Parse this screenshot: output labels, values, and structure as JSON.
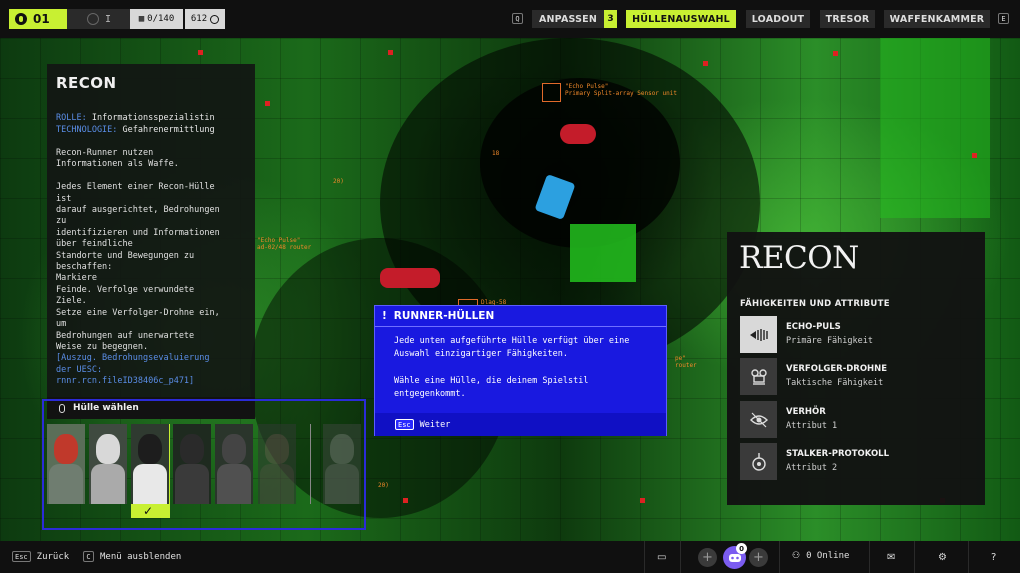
{
  "topbar": {
    "level": "01",
    "rank": "I",
    "counter": "0/140",
    "currency": "612",
    "key_left": "Q",
    "key_right": "E",
    "nav": [
      {
        "label": "ANPASSEN",
        "active": false
      },
      {
        "label": "HÜLLENAUSWAHL",
        "active": true
      },
      {
        "label": "LOADOUT",
        "active": false
      },
      {
        "label": "TRESOR",
        "active": false
      },
      {
        "label": "WAFFENKAMMER",
        "active": false
      }
    ],
    "anpassen_badge": "3"
  },
  "info_panel": {
    "title": "RECON",
    "role_key": "ROLLE:",
    "role_value": "Informationsspezialistin",
    "tech_key": "TECHNOLOGIE:",
    "tech_value": "Gefahrenermittlung",
    "body": "Recon-Runner nutzen\nInformationen als Waffe.\n\nJedes Element einer Recon-Hülle\nist\ndarauf ausgerichtet, Bedrohungen\nzu\nidentifizieren und Informationen\nüber feindliche\nStandorte und Bewegungen zu\nbeschaffen:\nMarkiere\nFeinde. Verfolge verwundete\nZiele.\nSetze eine Verfolger-Drohne ein,\num\nBedrohungen auf unerwartete\nWeise zu begegnen.",
    "quote": "[Auszug. Bedrohungsevaluierung\nder UESC:\nrnnr.rcn.fileID38406c_p471]"
  },
  "picker": {
    "label": "Hülle wählen",
    "shells": [
      "shell-1",
      "shell-2",
      "recon",
      "shell-4",
      "shell-5",
      "shell-6",
      "shell-locked"
    ]
  },
  "tip": {
    "title": "RUNNER-HÜLLEN",
    "p1": "Jede unten aufgeführte Hülle verfügt über eine Auswahl einzigartiger Fähigkeiten.",
    "p2": "Wähle eine Hülle, die deinem Spielstil entgegenkommt.",
    "key": "Esc",
    "action": "Weiter"
  },
  "abilities": {
    "title": "RECON",
    "subtitle": "FÄHIGKEITEN UND ATTRIBUTE",
    "items": [
      {
        "name": "ECHO-PULS",
        "type": "Primäre Fähigkeit",
        "icon": "echo-pulse-icon"
      },
      {
        "name": "VERFOLGER-DROHNE",
        "type": "Taktische Fähigkeit",
        "icon": "drone-icon"
      },
      {
        "name": "VERHÖR",
        "type": "Attribut 1",
        "icon": "interrogate-icon"
      },
      {
        "name": "STALKER-PROTOKOLL",
        "type": "Attribut 2",
        "icon": "stalker-icon"
      }
    ]
  },
  "hud": {
    "tag1_l1": "\"Echo Pulse\"",
    "tag1_l2": "Primary Split-array Sensor unit",
    "tag2_l1": "\"Echo Pulse\"",
    "tag2_l2": "ad-02/48 router",
    "tag3": "Dlag-58",
    "tag4_l1": "pe\"",
    "tag4_l2": "router",
    "n1": "18",
    "n2": "20)",
    "n3": "20)"
  },
  "bottombar": {
    "back_key": "Esc",
    "back_label": "Zurück",
    "menu_key": "C",
    "menu_label": "Menü ausblenden",
    "party_count": "0",
    "online": "0 Online",
    "help": "?"
  },
  "colors": {
    "accent": "#c8f032",
    "tip_blue": "#1919e0",
    "frame_blue": "#2b2bd8",
    "link_blue": "#5a8de6"
  }
}
